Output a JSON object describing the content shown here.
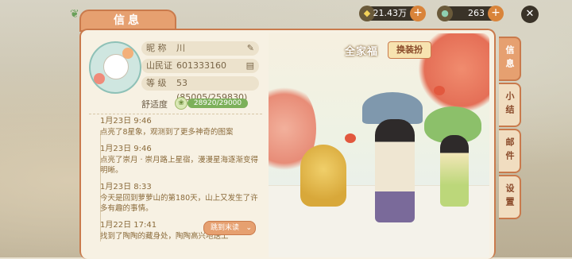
{
  "title": "信息",
  "currency": [
    {
      "icon": "coin-icon",
      "value": "21.43万"
    },
    {
      "icon": "gem-icon",
      "value": "263"
    }
  ],
  "profile": {
    "nickname_label": "昵  称",
    "nickname": "川",
    "id_label": "山民证",
    "id": "601333160",
    "level_label": "等  级",
    "level": "53 (85005/259830)",
    "comfort_label": "舒适度",
    "comfort_value": "28920/29000",
    "comfort_fraction": 0.997
  },
  "log": [
    {
      "date": "1月23日 9:46",
      "text": "点亮了8星象，观测到了更多神奇的图案"
    },
    {
      "date": "1月23日 9:46",
      "text": "点亮了崇月 · 崇月路上星宿，漫漫星海逐渐变得明晰。"
    },
    {
      "date": "1月23日 8:33",
      "text": "今天是回到萝萝山的第180天，山上又发生了许多有趣的事情。"
    },
    {
      "date": "1月22日 17:41",
      "text": "找到了陶陶的藏身处，陶陶高兴地送上"
    }
  ],
  "jump_label": "跳到末读",
  "portrait": {
    "title": "全家福",
    "outfit_button": "换装扮"
  },
  "side_tabs": [
    "信息",
    "小结",
    "邮件",
    "设置"
  ],
  "colors": {
    "accent": "#c97a4c",
    "tab_active": "#e6a070",
    "progress": "#7cb05a"
  }
}
